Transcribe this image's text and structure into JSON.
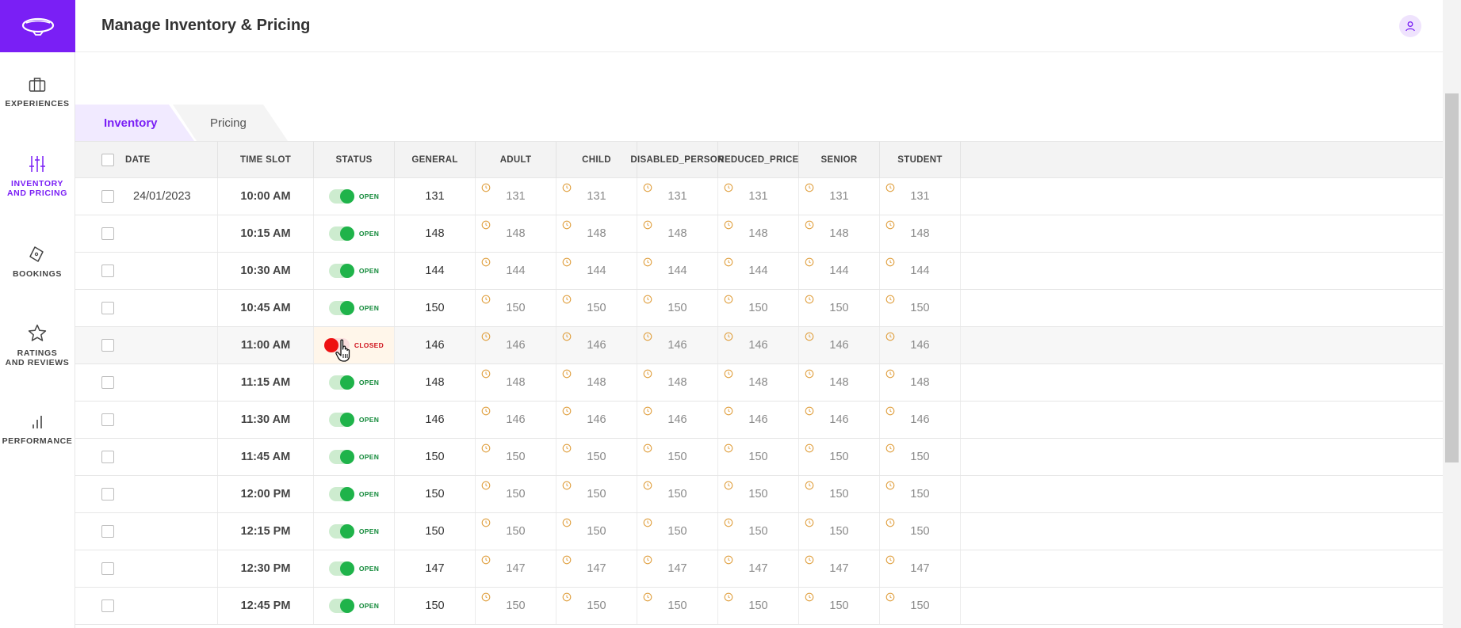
{
  "header": {
    "title": "Manage Inventory & Pricing"
  },
  "sidebar": {
    "items": [
      {
        "label_line1": "EXPERIENCES",
        "label_line2": "",
        "icon": "briefcase-icon",
        "active": false
      },
      {
        "label_line1": "INVENTORY",
        "label_line2": "AND PRICING",
        "icon": "sliders-icon",
        "active": true
      },
      {
        "label_line1": "BOOKINGS",
        "label_line2": "",
        "icon": "ticket-icon",
        "active": false
      },
      {
        "label_line1": "RATINGS",
        "label_line2": "AND REVIEWS",
        "icon": "star-icon",
        "active": false
      },
      {
        "label_line1": "PERFORMANCE",
        "label_line2": "",
        "icon": "bar-chart-icon",
        "active": false
      }
    ]
  },
  "tabs": [
    {
      "label": "Inventory",
      "active": true
    },
    {
      "label": "Pricing",
      "active": false
    }
  ],
  "table": {
    "columns": [
      "DATE",
      "TIME SLOT",
      "STATUS",
      "GENERAL",
      "ADULT",
      "CHILD",
      "DISABLED_PERSON",
      "REDUCED_PRICE",
      "SENIOR",
      "STUDENT"
    ],
    "date": "24/01/2023",
    "rows": [
      {
        "time": "10:00 AM",
        "status": "OPEN",
        "general": "131",
        "qty": "131"
      },
      {
        "time": "10:15 AM",
        "status": "OPEN",
        "general": "148",
        "qty": "148"
      },
      {
        "time": "10:30 AM",
        "status": "OPEN",
        "general": "144",
        "qty": "144"
      },
      {
        "time": "10:45 AM",
        "status": "OPEN",
        "general": "150",
        "qty": "150"
      },
      {
        "time": "11:00 AM",
        "status": "CLOSED",
        "general": "146",
        "qty": "146"
      },
      {
        "time": "11:15 AM",
        "status": "OPEN",
        "general": "148",
        "qty": "148"
      },
      {
        "time": "11:30 AM",
        "status": "OPEN",
        "general": "146",
        "qty": "146"
      },
      {
        "time": "11:45 AM",
        "status": "OPEN",
        "general": "150",
        "qty": "150"
      },
      {
        "time": "12:00 PM",
        "status": "OPEN",
        "general": "150",
        "qty": "150"
      },
      {
        "time": "12:15 PM",
        "status": "OPEN",
        "general": "150",
        "qty": "150"
      },
      {
        "time": "12:30 PM",
        "status": "OPEN",
        "general": "147",
        "qty": "147"
      },
      {
        "time": "12:45 PM",
        "status": "OPEN",
        "general": "150",
        "qty": "150"
      }
    ]
  },
  "colors": {
    "accent": "#7a1ff5",
    "open": "#1fb34a",
    "closed": "#e11111",
    "timer": "#e0a040"
  }
}
